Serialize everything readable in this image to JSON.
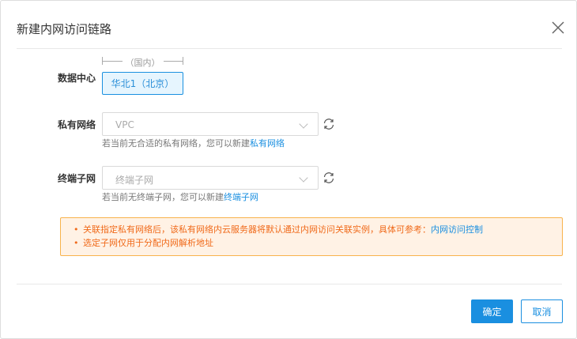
{
  "dialog": {
    "title": "新建内网访问链路"
  },
  "datacenter": {
    "label": "数据中心",
    "region": "（国内）",
    "option": "华北1（北京）"
  },
  "vpc": {
    "label": "私有网络",
    "placeholder": "VPC",
    "hint": "若当前无合适的私有网络，您可以新建",
    "hint_link": "私有网络"
  },
  "subnet": {
    "label": "终端子网",
    "placeholder": "终端子网",
    "hint": "若当前无终端子网，您可以新建",
    "hint_link": "终端子网"
  },
  "alert": {
    "item1": "关联指定私有网络后，该私有网络内云服务器将默认通过内网访问关联实例，具体可参考：",
    "item1_link": "内网访问控制",
    "item2": "选定子网仅用于分配内网解析地址"
  },
  "footer": {
    "ok": "确定",
    "cancel": "取消"
  }
}
